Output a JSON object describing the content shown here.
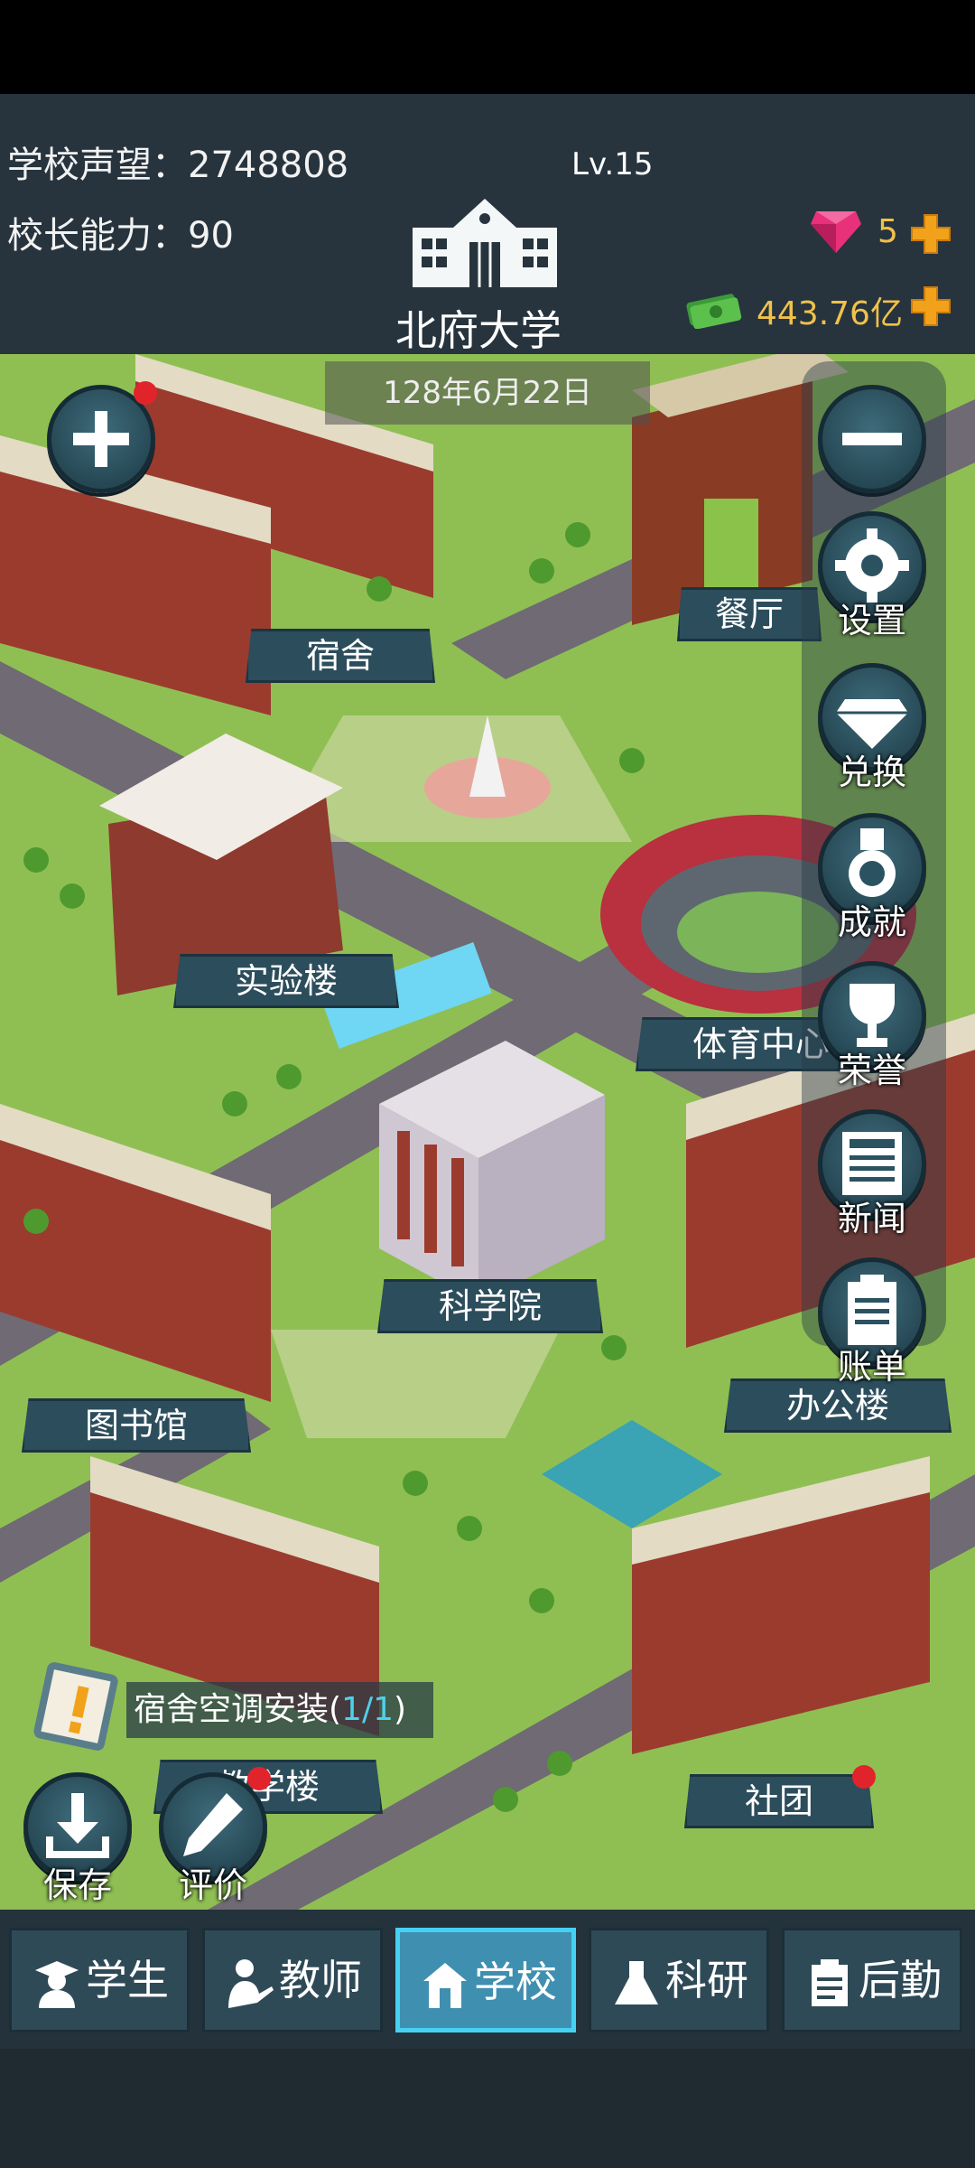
{
  "header": {
    "reputation_label": "学校声望：",
    "reputation_value": "2748808",
    "ability_label": "校长能力：",
    "ability_value": "90",
    "school_name": "北府大学",
    "level": "Lv.15",
    "gems": "5",
    "money": "443.76亿"
  },
  "map": {
    "date": "128年6月22日",
    "buildings": {
      "dorm": "宿舍",
      "canteen": "餐厅",
      "lab": "实验楼",
      "stadium": "体育中心",
      "science": "科学院",
      "library": "图书馆",
      "office": "办公楼",
      "teaching": "教学楼",
      "club": "社团"
    }
  },
  "side_menu": {
    "settings": "设置",
    "exchange": "兑换",
    "achievements": "成就",
    "honors": "荣誉",
    "news": "新闻",
    "bills": "账单"
  },
  "task": {
    "text": "宿舍空调安装(",
    "progress": "1/1",
    "close": ")"
  },
  "actions": {
    "save": "保存",
    "review": "评价"
  },
  "nav": {
    "students": "学生",
    "teachers": "教师",
    "school": "学校",
    "research": "科研",
    "logistics": "后勤"
  },
  "colors": {
    "header_bg": "#27343e",
    "gold": "#f0c24a",
    "active_tab": "#46d1f2",
    "grass": "#8fbf53",
    "brick": "#9b3b2e"
  }
}
